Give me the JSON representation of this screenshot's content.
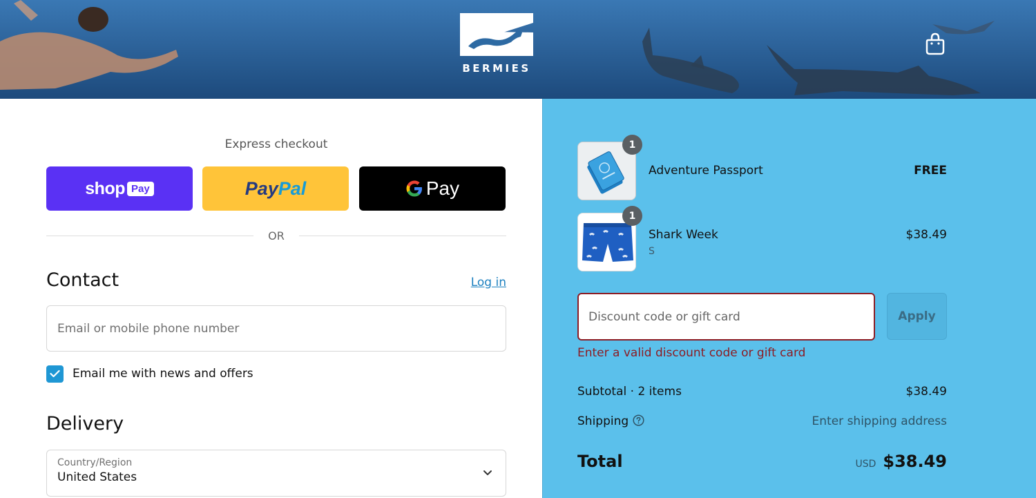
{
  "header": {
    "brand_name": "BERMIES",
    "cart_icon": "shopping-bag-icon"
  },
  "express_checkout": {
    "title": "Express checkout",
    "shop_pay": {
      "shop_text": "shop",
      "pay_text": "Pay"
    },
    "paypal": {
      "pay_text": "Pay",
      "pal_text": "Pal"
    },
    "google_pay": {
      "pay_text": "Pay"
    },
    "or_divider": "OR"
  },
  "contact": {
    "title": "Contact",
    "login_link": "Log in",
    "email_placeholder": "Email or mobile phone number",
    "email_value": "",
    "newsletter_label": "Email me with news and offers",
    "newsletter_checked": true
  },
  "delivery": {
    "title": "Delivery",
    "country_label": "Country/Region",
    "country_value": "United States"
  },
  "order_summary": {
    "items": [
      {
        "name": "Adventure Passport",
        "variant": "",
        "quantity": "1",
        "price": "FREE"
      },
      {
        "name": "Shark Week",
        "variant": "S",
        "quantity": "1",
        "price": "$38.49"
      }
    ],
    "discount": {
      "placeholder": "Discount code or gift card",
      "value": "",
      "apply_label": "Apply",
      "error": "Enter a valid discount code or gift card"
    },
    "subtotal_label": "Subtotal · 2 items",
    "subtotal_value": "$38.49",
    "shipping_label": "Shipping",
    "shipping_value": "Enter shipping address",
    "total_label": "Total",
    "total_currency": "USD",
    "total_value": "$38.49"
  },
  "colors": {
    "summary_bg": "#5bc0eb",
    "shop_pay": "#5a31f4",
    "paypal": "#ffc439",
    "google_pay": "#000000",
    "error": "#8c1c24",
    "link": "#1a7fbf",
    "checkbox": "#1f97d4"
  }
}
